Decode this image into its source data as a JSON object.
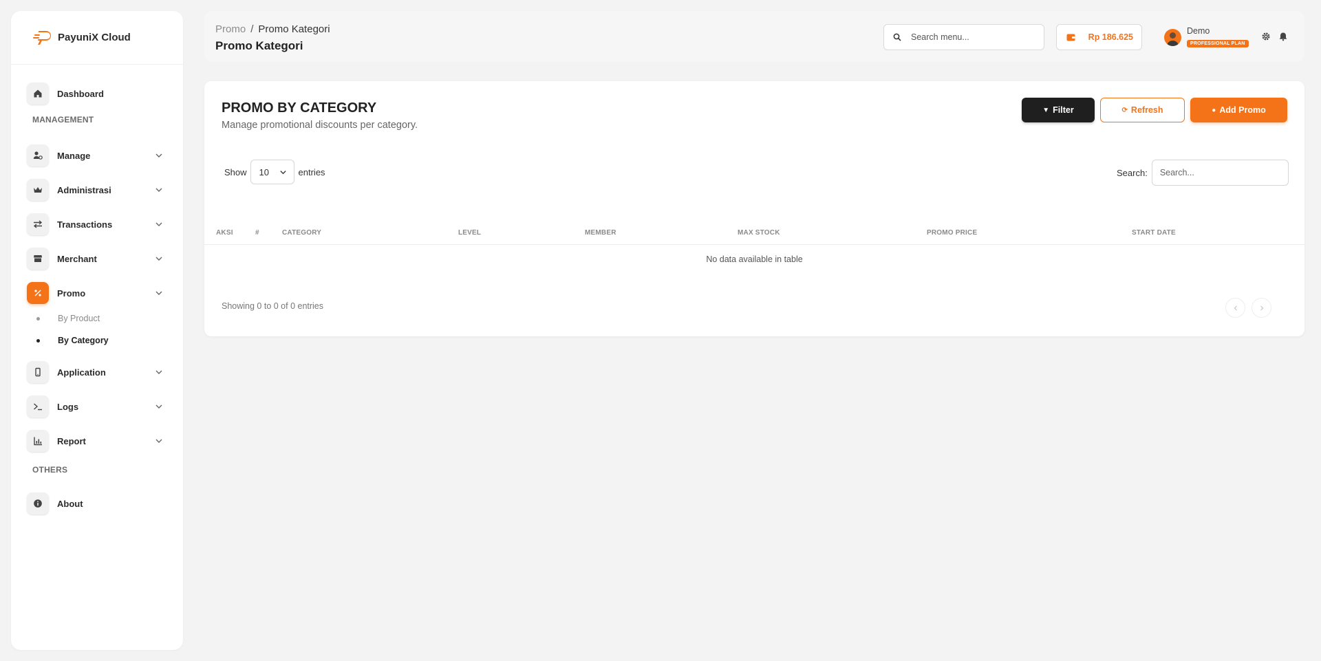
{
  "brand": {
    "name": "PayuniX Cloud"
  },
  "colors": {
    "accent": "#f57318",
    "dark": "#1f1f1f"
  },
  "sidebar": {
    "dashboard": {
      "label": "Dashboard",
      "icon": "home-icon"
    },
    "management_title": "MANAGEMENT",
    "items": [
      {
        "label": "Manage",
        "icon": "user-gear-icon"
      },
      {
        "label": "Administrasi",
        "icon": "crown-icon"
      },
      {
        "label": "Transactions",
        "icon": "arrows-exchange-icon"
      },
      {
        "label": "Merchant",
        "icon": "store-icon"
      },
      {
        "label": "Promo",
        "icon": "percent-icon",
        "active": true
      },
      {
        "label": "Application",
        "icon": "mobile-icon"
      },
      {
        "label": "Logs",
        "icon": "terminal-icon"
      },
      {
        "label": "Report",
        "icon": "chart-icon"
      }
    ],
    "promo_sub": [
      {
        "label": "By Product"
      },
      {
        "label": "By Category",
        "current": true
      }
    ],
    "others_title": "OTHERS",
    "about": {
      "label": "About",
      "icon": "info-icon"
    }
  },
  "topbar": {
    "breadcrumb": {
      "parent": "Promo",
      "separator": "/",
      "current": "Promo Kategori"
    },
    "title": "Promo Kategori",
    "search_placeholder": "Search menu...",
    "balance": "Rp 186.625",
    "user": {
      "name": "Demo",
      "plan": "PROFESSIONAL PLAN"
    }
  },
  "card": {
    "title": "PROMO BY CATEGORY",
    "subtitle": "Manage promotional discounts per category.",
    "buttons": {
      "filter": "Filter",
      "refresh": "Refresh",
      "add": "Add Promo"
    },
    "length": {
      "show": "Show",
      "value": "10",
      "entries": "entries"
    },
    "search": {
      "label": "Search:",
      "placeholder": "Search..."
    },
    "columns": [
      "AKSI",
      "#",
      "CATEGORY",
      "LEVEL",
      "MEMBER",
      "MAX STOCK",
      "PROMO PRICE",
      "START DATE"
    ],
    "empty": "No data available in table",
    "info": "Showing 0 to 0 of 0 entries"
  }
}
